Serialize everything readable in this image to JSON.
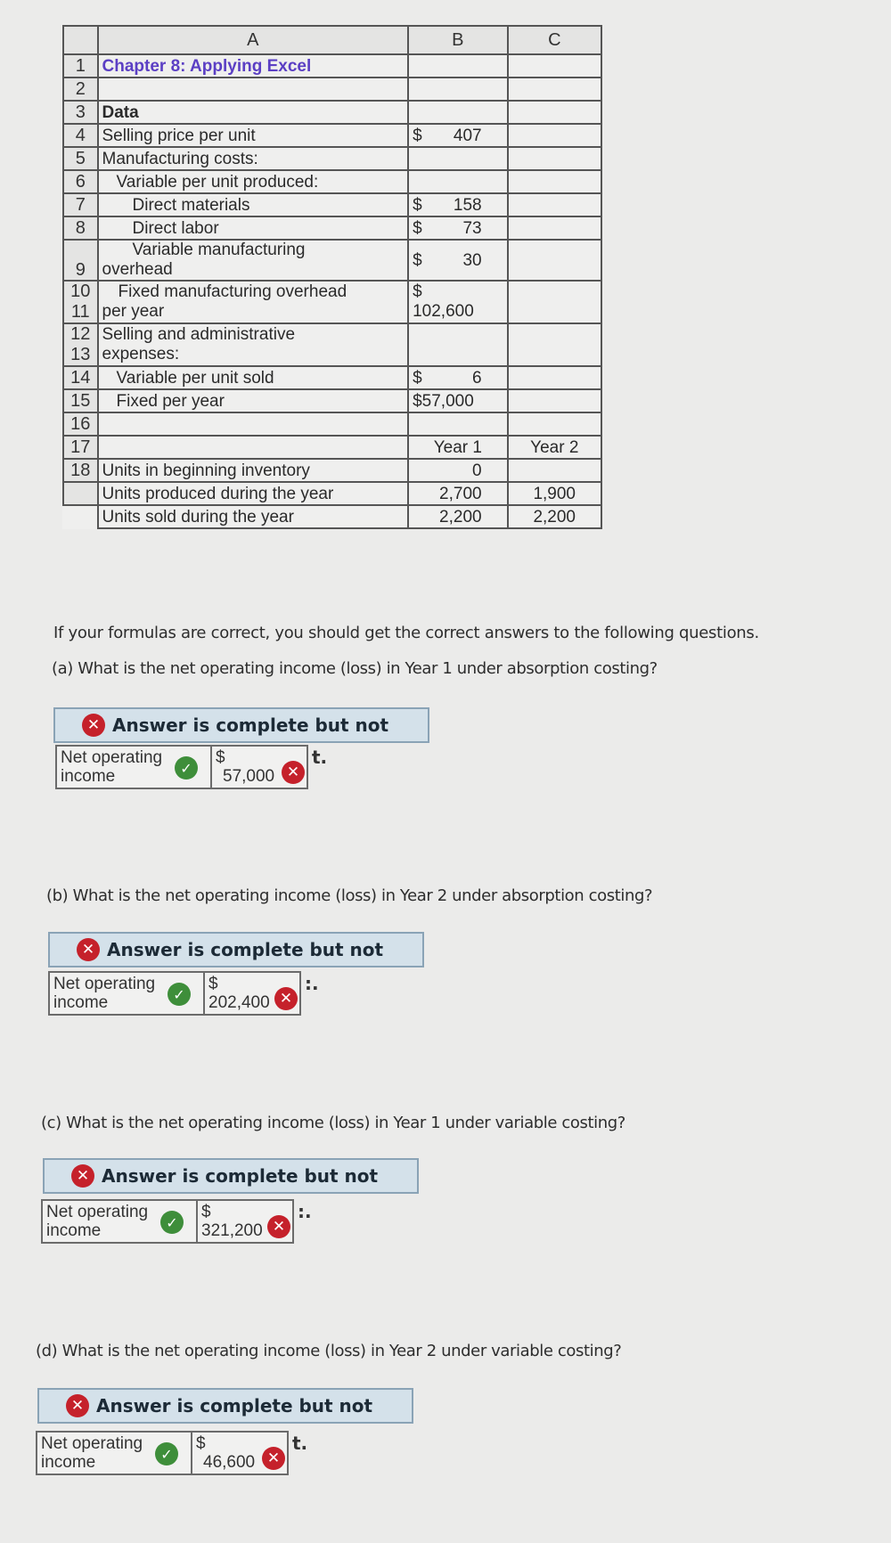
{
  "spreadsheet": {
    "column_headers": [
      "A",
      "B",
      "C"
    ],
    "rows": [
      {
        "num": "1",
        "a": "Chapter 8: Applying Excel"
      },
      {
        "num": "2",
        "a": ""
      },
      {
        "num": "3",
        "a": "Data"
      },
      {
        "num": "4",
        "a": "Selling price per unit",
        "b_sym": "$",
        "b_amt": "407"
      },
      {
        "num": "5",
        "a": "Manufacturing costs:"
      },
      {
        "num": "6",
        "a": "Variable per unit produced:"
      },
      {
        "num": "7",
        "a": "Direct materials",
        "b_sym": "$",
        "b_amt": "158"
      },
      {
        "num": "8",
        "a": "Direct labor",
        "b_sym": "$",
        "b_amt": "73"
      },
      {
        "num": "9",
        "a_line1": "Variable manufacturing",
        "a_line2": "overhead",
        "b_sym": "$",
        "b_amt": "30"
      },
      {
        "num": "10",
        "num2": "11",
        "a_line1": "Fixed manufacturing overhead",
        "a_line2": "per year",
        "b_sym": "$",
        "b_amt": "102,600"
      },
      {
        "num": "12",
        "num2": "13",
        "a_line1": "Selling and administrative",
        "a_line2": "expenses:"
      },
      {
        "num": "14",
        "a": "Variable per unit sold",
        "b_sym": "$",
        "b_amt": "6"
      },
      {
        "num": "15",
        "a": "Fixed per year",
        "b": "$57,000"
      },
      {
        "num": "16",
        "a": ""
      },
      {
        "num": "17",
        "a": "",
        "b": "Year 1",
        "c": "Year 2"
      },
      {
        "num": "18",
        "a": "Units in beginning inventory",
        "b": "0",
        "c": ""
      },
      {
        "num": "",
        "a": "Units produced during the year",
        "b": "2,700",
        "c": "1,900"
      },
      {
        "num": "",
        "a": "Units sold during the year",
        "b": "2,200",
        "c": "2,200"
      }
    ]
  },
  "intro_text": "If your formulas are correct, you should get the correct answers to the following questions.",
  "questions": [
    {
      "prompt": "(a) What is the net operating income (loss) in Year 1 under absorption costing?",
      "feedback": "Answer is complete but not",
      "label_line1": "Net operating",
      "label_line2": "income",
      "currency": "$",
      "value": "57,000",
      "trail": "t."
    },
    {
      "prompt": "(b) What is the net operating income (loss) in Year 2 under absorption costing?",
      "feedback": "Answer is complete but not",
      "label_line1": "Net operating",
      "label_line2": "income",
      "currency": "$",
      "value": "202,400",
      "trail": ":."
    },
    {
      "prompt": "(c) What is the net operating income (loss) in Year 1 under variable costing?",
      "feedback": "Answer is complete but not",
      "label_line1": "Net operating",
      "label_line2": "income",
      "currency": "$",
      "value": "321,200",
      "trail": ":."
    },
    {
      "prompt": "(d) What is the net operating income (loss) in Year 2 under variable costing?",
      "feedback": "Answer is complete but not",
      "label_line1": "Net operating",
      "label_line2": "income",
      "currency": "$",
      "value": "46,600",
      "trail": "t."
    }
  ],
  "icons": {
    "incorrect": "✕",
    "correct": "✓"
  },
  "colors": {
    "title": "#5b3fc4",
    "feedback_bg": "#d4e1ea",
    "incorrect": "#c5212b",
    "correct": "#3e8e3a"
  }
}
